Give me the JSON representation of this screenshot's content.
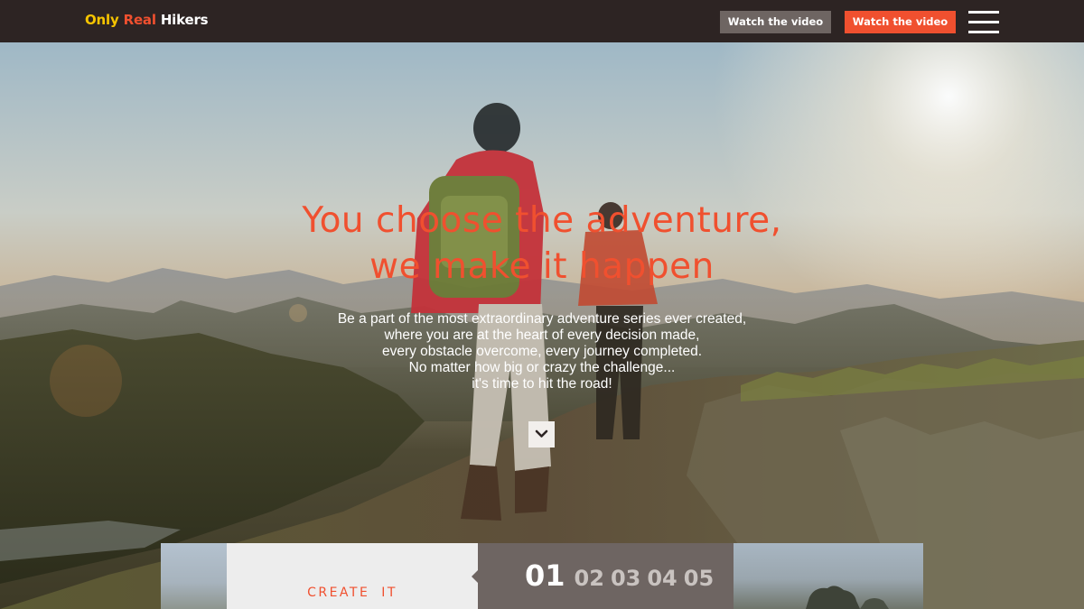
{
  "header": {
    "logo": {
      "word1": "Only",
      "word2": "Real",
      "word3": "Hikers"
    },
    "buttons": [
      {
        "label": "Watch the video"
      },
      {
        "label": "Watch the video"
      }
    ],
    "menu_icon": "hamburger-menu-icon"
  },
  "hero": {
    "headline": [
      "You choose the adventure,",
      "we make it happen"
    ],
    "body": [
      "Be a part of the most extraordinary adventure series ever created,",
      "where you are at the heart of every decision made,",
      "every obstacle overcome, every journey completed.",
      "No matter how big or crazy the challenge...",
      "it's time to hit the road!"
    ],
    "scroll_icon": "chevron-down-icon"
  },
  "strip": {
    "card_label": "CREATE IT",
    "pages": [
      "01",
      "02",
      "03",
      "04",
      "05"
    ],
    "active_page": "01"
  },
  "colors": {
    "accent": "#f0502f",
    "logo_yellow": "#f5c400",
    "topbar": "#2d2423",
    "gray_button": "#6e6562"
  }
}
